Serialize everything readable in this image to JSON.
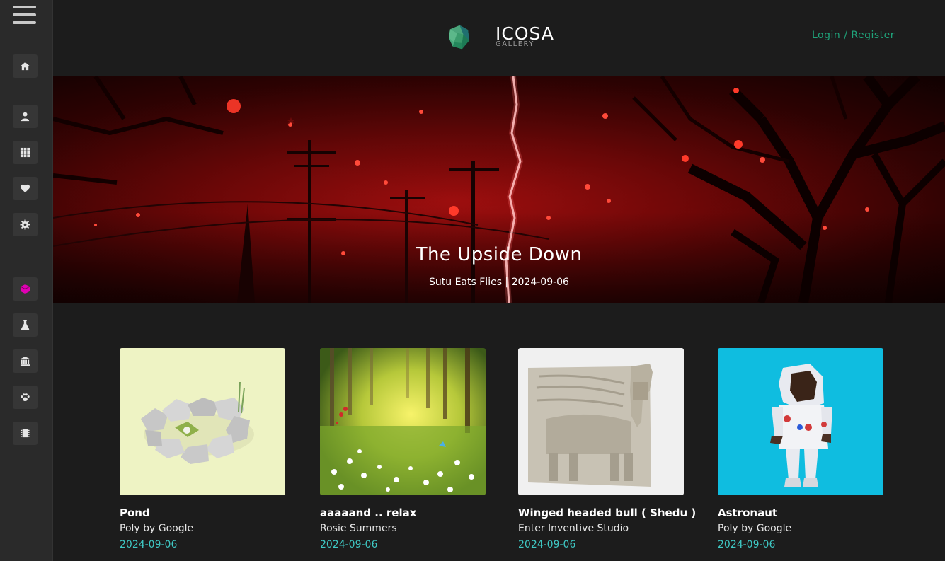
{
  "header": {
    "logo_main": "ICOSA",
    "logo_sub": "GALLERY",
    "login_label": "Login / Register"
  },
  "sidebar": {
    "items": [
      {
        "icon": "home-icon"
      },
      {
        "icon": "user-icon"
      },
      {
        "icon": "grid-icon"
      },
      {
        "icon": "heart-icon"
      },
      {
        "icon": "gear-icon"
      },
      {
        "icon": "cube-icon",
        "color": "#e000b4"
      },
      {
        "icon": "flask-icon"
      },
      {
        "icon": "museum-icon"
      },
      {
        "icon": "paw-icon"
      },
      {
        "icon": "chip-icon"
      }
    ]
  },
  "hero": {
    "title": "The Upside Down",
    "subtitle": "Sutu Eats Flies | 2024-09-06"
  },
  "cards": [
    {
      "title": "Pond",
      "author": "Poly by Google",
      "date": "2024-09-06"
    },
    {
      "title": "aaaaand .. relax",
      "author": "Rosie Summers",
      "date": "2024-09-06"
    },
    {
      "title": "Winged headed bull ( Shedu )",
      "author": "Enter Inventive Studio",
      "date": "2024-09-06"
    },
    {
      "title": "Astronaut",
      "author": "Poly by Google",
      "date": "2024-09-06"
    }
  ],
  "colors": {
    "accent_login": "#1fa37a",
    "date": "#3fc9c5",
    "background": "#1c1c1c",
    "sidebar": "#2a2a2a"
  }
}
